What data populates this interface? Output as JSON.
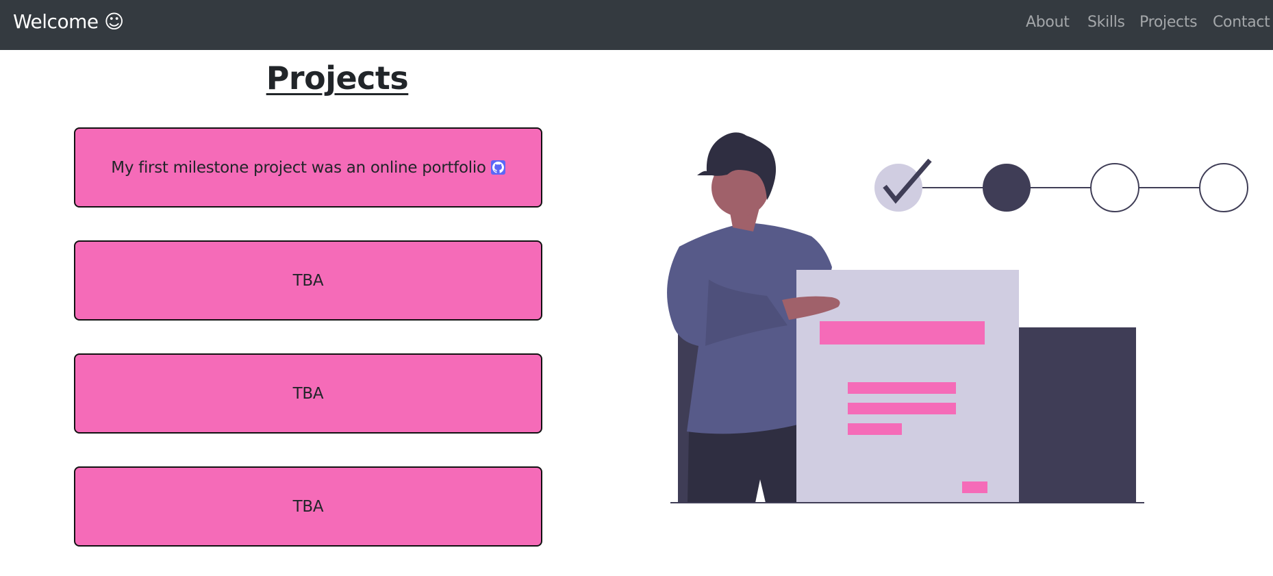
{
  "navbar": {
    "brand": "Welcome",
    "brand_icon": "☺",
    "links": [
      "About",
      "Skills",
      "Projects",
      "Contact"
    ]
  },
  "main": {
    "title": "Projects",
    "projects": [
      {
        "text": "My first milestone project was an online portfolio",
        "icon": "github-icon"
      },
      {
        "text": "TBA"
      },
      {
        "text": "TBA"
      },
      {
        "text": "TBA"
      }
    ]
  },
  "colors": {
    "navbar_bg": "#343a40",
    "card_pink": "#f56bb8",
    "github_icon_bg": "#5b68f7",
    "illustration_dark": "#3f3d56",
    "illustration_light": "#d0cde1",
    "illustration_purple": "#575a89",
    "skin": "#a0616a"
  }
}
